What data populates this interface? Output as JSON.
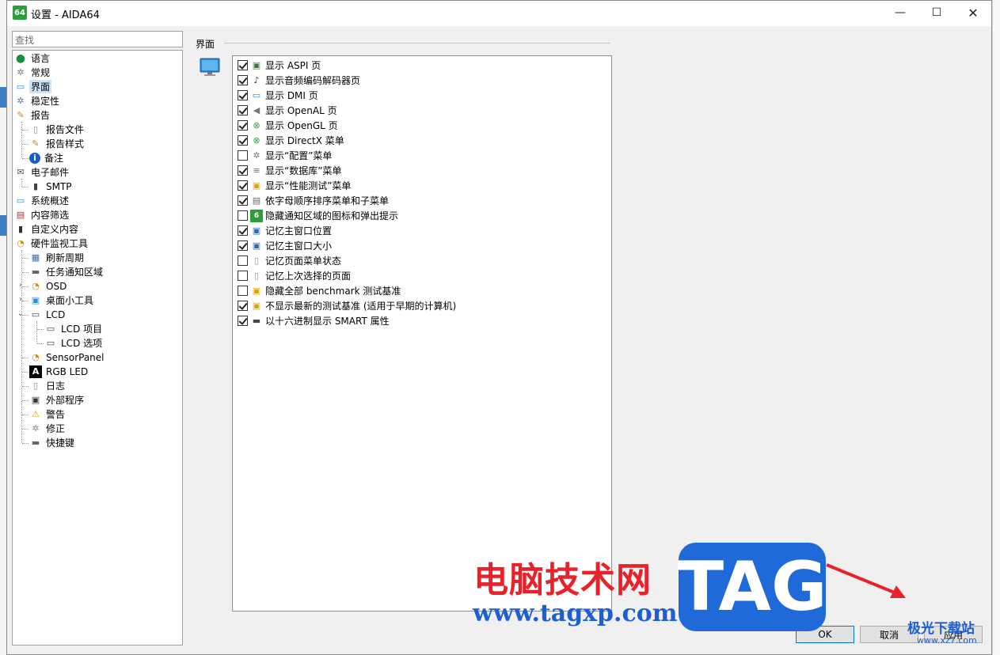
{
  "window": {
    "app_icon": "64",
    "title": "设置 - AIDA64",
    "minimize": "—",
    "maximize": "☐",
    "close": "✕"
  },
  "search": {
    "placeholder": "查找"
  },
  "tree": [
    {
      "label": "语言",
      "icon": "globe-icon",
      "level": 0
    },
    {
      "label": "常规",
      "icon": "gear-icon",
      "level": 0
    },
    {
      "label": "界面",
      "icon": "monitor-icon",
      "level": 0,
      "selected": true
    },
    {
      "label": "稳定性",
      "icon": "gear-shield-icon",
      "level": 0
    },
    {
      "label": "报告",
      "icon": "report-icon",
      "level": 0
    },
    {
      "label": "报告文件",
      "icon": "document-icon",
      "level": 1
    },
    {
      "label": "报告样式",
      "icon": "style-icon",
      "level": 1
    },
    {
      "label": "备注",
      "icon": "info-icon",
      "level": 1
    },
    {
      "label": "电子邮件",
      "icon": "mail-icon",
      "level": 0
    },
    {
      "label": "SMTP",
      "icon": "phone-icon",
      "level": 1
    },
    {
      "label": "系统概述",
      "icon": "computer-icon",
      "level": 0
    },
    {
      "label": "内容筛选",
      "icon": "filter-icon",
      "level": 0
    },
    {
      "label": "自定义内容",
      "icon": "custom-icon",
      "level": 0
    },
    {
      "label": "硬件监视工具",
      "icon": "gauge-icon",
      "level": 0
    },
    {
      "label": "刷新周期",
      "icon": "refresh-icon",
      "level": 1
    },
    {
      "label": "任务通知区域",
      "icon": "tray-icon",
      "level": 1
    },
    {
      "label": "OSD",
      "icon": "gauge-icon",
      "level": 1,
      "expander": "›"
    },
    {
      "label": "桌面小工具",
      "icon": "gadget-icon",
      "level": 1,
      "expander": "›"
    },
    {
      "label": "LCD",
      "icon": "lcd-icon",
      "level": 1,
      "expander": "⌄"
    },
    {
      "label": "LCD 项目",
      "icon": "lcd-icon",
      "level": 2
    },
    {
      "label": "LCD 选项",
      "icon": "lcd-icon",
      "level": 2
    },
    {
      "label": "SensorPanel",
      "icon": "gauge-icon",
      "level": 1
    },
    {
      "label": "RGB LED",
      "icon": "rgb-icon",
      "level": 1
    },
    {
      "label": "日志",
      "icon": "document-icon",
      "level": 1
    },
    {
      "label": "外部程序",
      "icon": "program-icon",
      "level": 1
    },
    {
      "label": "警告",
      "icon": "warning-icon",
      "level": 1
    },
    {
      "label": "修正",
      "icon": "wrench-icon",
      "level": 1
    },
    {
      "label": "快捷键",
      "icon": "keyboard-icon",
      "level": 1
    }
  ],
  "content": {
    "group_title": "界面",
    "options": [
      {
        "label": "显示 ASPI 页",
        "checked": true,
        "icon": "aspi-icon"
      },
      {
        "label": "显示音频编码解码器页",
        "checked": true,
        "icon": "audio-icon"
      },
      {
        "label": "显示 DMI 页",
        "checked": true,
        "icon": "monitor-icon"
      },
      {
        "label": "显示 OpenAL 页",
        "checked": true,
        "icon": "speaker-icon"
      },
      {
        "label": "显示 OpenGL 页",
        "checked": true,
        "icon": "xbox-icon"
      },
      {
        "label": "显示 DirectX 菜单",
        "checked": true,
        "icon": "xbox-icon"
      },
      {
        "label": "显示“配置”菜单",
        "checked": false,
        "icon": "gear-icon"
      },
      {
        "label": "显示“数据库”菜单",
        "checked": true,
        "icon": "database-icon"
      },
      {
        "label": "显示“性能测试”菜单",
        "checked": true,
        "icon": "benchmark-icon"
      },
      {
        "label": "依字母顺序排序菜单和子菜单",
        "checked": true,
        "icon": "sort-icon"
      },
      {
        "label": "隐藏通知区域的图标和弹出提示",
        "checked": false,
        "icon": "aida-icon"
      },
      {
        "label": "记忆主窗口位置",
        "checked": true,
        "icon": "window-icon"
      },
      {
        "label": "记忆主窗口大小",
        "checked": true,
        "icon": "window-icon"
      },
      {
        "label": "记忆页面菜单状态",
        "checked": false,
        "icon": "page-icon"
      },
      {
        "label": "记忆上次选择的页面",
        "checked": false,
        "icon": "page-icon"
      },
      {
        "label": "隐藏全部 benchmark 测试基准",
        "checked": false,
        "icon": "benchmark-icon"
      },
      {
        "label": "不显示最新的测试基准 (适用于早期的计算机)",
        "checked": true,
        "icon": "benchmark-icon"
      },
      {
        "label": "以十六进制显示 SMART 属性",
        "checked": true,
        "icon": "drive-icon"
      }
    ]
  },
  "buttons": {
    "ok": "OK",
    "cancel": "取消",
    "apply": "应用"
  },
  "watermark": {
    "cn": "电脑技术网",
    "url": "www.tagxp.com",
    "tag": "TAG",
    "site": "极光下载站",
    "site_url": "www.xz7.com"
  },
  "colors": {
    "selection": "#cce4f7",
    "accent": "#0078d7",
    "watermark_red": "#e8222a",
    "watermark_blue": "#1f6ad8"
  }
}
